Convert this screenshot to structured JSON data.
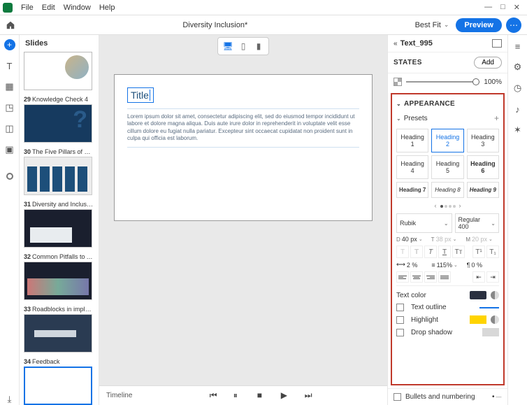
{
  "menu": {
    "file": "File",
    "edit": "Edit",
    "window": "Window",
    "help": "Help"
  },
  "doc": {
    "title": "Diversity Inclusion*",
    "fit": "Best Fit",
    "preview": "Preview"
  },
  "slidesHeader": "Slides",
  "slides": [
    {
      "num": "",
      "title": ""
    },
    {
      "num": "29",
      "title": "Knowledge Check 4"
    },
    {
      "num": "30",
      "title": "The Five Pillars of DEI"
    },
    {
      "num": "31",
      "title": "Diversity and Inclusion Bes..."
    },
    {
      "num": "32",
      "title": "Common Pitfalls to Avoid"
    },
    {
      "num": "33",
      "title": "Roadblocks in implementi..."
    },
    {
      "num": "34",
      "title": "Feedback"
    }
  ],
  "stage": {
    "title": "Title",
    "body": "Lorem ipsum dolor sit amet, consectetur adipiscing elit, sed do eiusmod tempor incididunt ut labore et dolore magna aliqua. Duis aute irure dolor in reprehenderit in voluptate velit esse cillum dolore eu fugiat nulla pariatur. Excepteur sint occaecat cupidatat non proident sunt in culpa qui officia est laborum."
  },
  "timeline": "Timeline",
  "props": {
    "objName": "Text_995",
    "states": "STATES",
    "add": "Add",
    "opacity": "100%"
  },
  "appearance": {
    "title": "APPEARANCE",
    "presets": "Presets",
    "items": [
      "Heading 1",
      "Heading 2",
      "Heading 3",
      "Heading 4",
      "Heading 5",
      "Heading 6",
      "Heading 7",
      "Heading 8",
      "Heading 9"
    ],
    "font": "Rubik",
    "weight": "Regular 400",
    "size": {
      "d": "40 px",
      "t": "38 px",
      "m": "20 px"
    },
    "letterSpacing": "2 %",
    "lineHeight": "115%",
    "paraSpacing": "0 %",
    "textColor": "Text color",
    "outline": "Text outline",
    "highlight": "Highlight",
    "shadow": "Drop shadow"
  },
  "bullets": "Bullets and numbering"
}
